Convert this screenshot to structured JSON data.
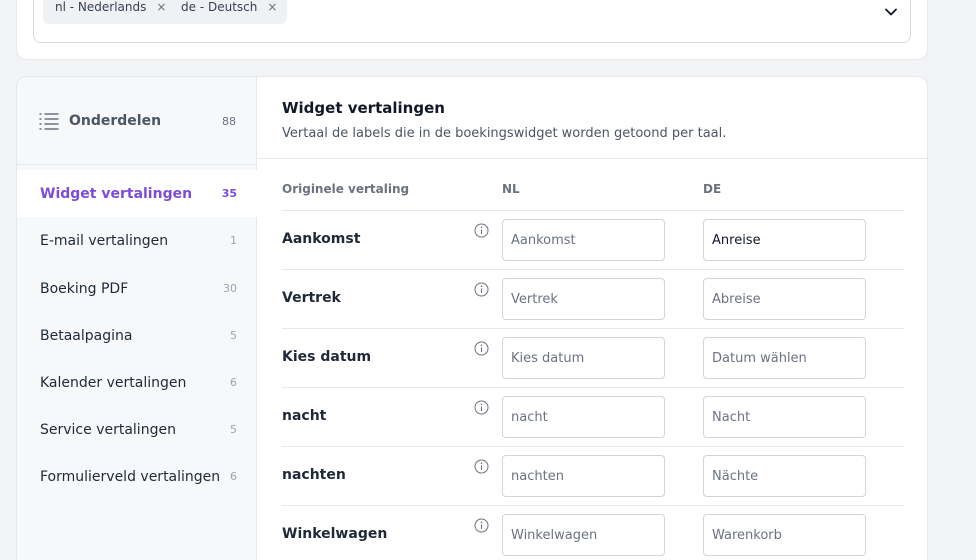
{
  "languages": {
    "chips": [
      {
        "label": "nl - Nederlands",
        "remove": "×"
      },
      {
        "label": "de - Deutsch",
        "remove": "×"
      }
    ]
  },
  "sidebar": {
    "title": "Onderdelen",
    "total": "88",
    "items": [
      {
        "label": "Widget vertalingen",
        "count": "35",
        "active": true
      },
      {
        "label": "E-mail vertalingen",
        "count": "1"
      },
      {
        "label": "Boeking PDF",
        "count": "30"
      },
      {
        "label": "Betaalpagina",
        "count": "5"
      },
      {
        "label": "Kalender vertalingen",
        "count": "6"
      },
      {
        "label": "Service vertalingen",
        "count": "5"
      },
      {
        "label": "Formulierveld vertalingen",
        "count": "6"
      }
    ]
  },
  "main": {
    "title": "Widget vertalingen",
    "description": "Vertaal de labels die in de boekingswidget worden getoond per taal.",
    "columns": {
      "original": "Originele vertaling",
      "nl": "NL",
      "de": "DE"
    },
    "rows": [
      {
        "label": "Aankomst",
        "nl_placeholder": "Aankomst",
        "nl_value": "",
        "de_placeholder": "",
        "de_value": "Anreise"
      },
      {
        "label": "Vertrek",
        "nl_placeholder": "Vertrek",
        "nl_value": "",
        "de_placeholder": "Abreise",
        "de_value": ""
      },
      {
        "label": "Kies datum",
        "nl_placeholder": "Kies datum",
        "nl_value": "",
        "de_placeholder": "Datum wählen",
        "de_value": ""
      },
      {
        "label": "nacht",
        "nl_placeholder": "nacht",
        "nl_value": "",
        "de_placeholder": "Nacht",
        "de_value": ""
      },
      {
        "label": "nachten",
        "nl_placeholder": "nachten",
        "nl_value": "",
        "de_placeholder": "Nächte",
        "de_value": ""
      },
      {
        "label": "Winkelwagen",
        "nl_placeholder": "Winkelwagen",
        "nl_value": "",
        "de_placeholder": "Warenkorb",
        "de_value": ""
      }
    ]
  },
  "colors": {
    "accent": "#7c4ddb",
    "border": "#e5e7eb",
    "sidebar_bg": "#f7f8fa"
  },
  "icons": {
    "list": "list-icon",
    "info": "info-icon",
    "chevron": "chevron-down-icon",
    "remove": "close-icon"
  }
}
